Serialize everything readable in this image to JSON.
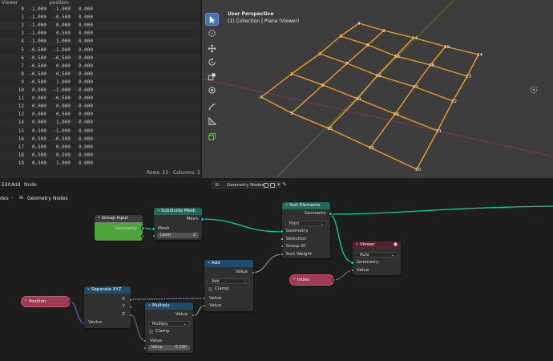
{
  "spreadsheet": {
    "header": {
      "viewer": "Viewer",
      "position": "position"
    },
    "rows": [
      {
        "i": "0",
        "x": "-1.000",
        "y": "-1.000",
        "z": "0.000"
      },
      {
        "i": "1",
        "x": "-1.000",
        "y": "-0.500",
        "z": "0.000"
      },
      {
        "i": "2",
        "x": "-1.000",
        "y": "0.000",
        "z": "0.000"
      },
      {
        "i": "3",
        "x": "-1.000",
        "y": "0.500",
        "z": "0.000"
      },
      {
        "i": "4",
        "x": "-1.000",
        "y": "1.000",
        "z": "0.000"
      },
      {
        "i": "5",
        "x": "-0.500",
        "y": "-1.000",
        "z": "0.000"
      },
      {
        "i": "6",
        "x": "-0.500",
        "y": "-0.500",
        "z": "0.000"
      },
      {
        "i": "7",
        "x": "-0.500",
        "y": "0.000",
        "z": "0.000"
      },
      {
        "i": "8",
        "x": "-0.500",
        "y": "0.500",
        "z": "0.000"
      },
      {
        "i": "9",
        "x": "-0.500",
        "y": "1.000",
        "z": "0.000"
      },
      {
        "i": "10",
        "x": "0.000",
        "y": "-1.000",
        "z": "0.000"
      },
      {
        "i": "11",
        "x": "0.000",
        "y": "-0.500",
        "z": "0.000"
      },
      {
        "i": "12",
        "x": "0.000",
        "y": "0.000",
        "z": "0.000"
      },
      {
        "i": "13",
        "x": "0.000",
        "y": "0.500",
        "z": "0.000"
      },
      {
        "i": "14",
        "x": "0.000",
        "y": "1.000",
        "z": "0.000"
      },
      {
        "i": "15",
        "x": "0.500",
        "y": "-1.000",
        "z": "0.000"
      },
      {
        "i": "16",
        "x": "0.500",
        "y": "-0.500",
        "z": "0.000"
      },
      {
        "i": "17",
        "x": "0.500",
        "y": "0.000",
        "z": "0.000"
      },
      {
        "i": "18",
        "x": "0.500",
        "y": "0.500",
        "z": "0.000"
      },
      {
        "i": "19",
        "x": "0.500",
        "y": "1.000",
        "z": "0.000"
      }
    ],
    "rows_label": "Rows: 25",
    "columns_label": "Columns: 2"
  },
  "viewport": {
    "view_name": "User Perspective",
    "collection_info": "(1) Collection | Plane (Viewer)",
    "vertex_labels": [
      "0",
      "1",
      "2",
      "3",
      "4",
      "5",
      "6",
      "7",
      "8",
      "9",
      "10",
      "11",
      "12",
      "13",
      "14",
      "15",
      "16",
      "17",
      "18",
      "19",
      "20",
      "21",
      "22",
      "23",
      "24"
    ],
    "colors": {
      "edge": "#f39c2a",
      "x_axis": "#a3475b",
      "y_axis": "#6b8e23"
    }
  },
  "node_editor": {
    "menu": {
      "edit": "Edit",
      "add": "Add",
      "node": "Node"
    },
    "breadcrumb_left": "des",
    "breadcrumb": "Geometry Nodes",
    "tree_name": "Geometry Nodes",
    "nodes": {
      "group_input": {
        "title": "Group Input",
        "geometry": "Geometry"
      },
      "subdivide": {
        "title": "Subdivide Mesh",
        "out_mesh": "Mesh",
        "in_mesh": "Mesh",
        "level_label": "Level",
        "level_value": "2"
      },
      "sort": {
        "title": "Sort Elements",
        "out_geometry": "Geometry",
        "domain": "Point",
        "geometry": "Geometry",
        "selection": "Selection",
        "group_id": "Group ID",
        "sort_weight": "Sort Weight"
      },
      "add": {
        "title": "Add",
        "out_value": "Value",
        "operation": "Add",
        "clamp": "Clamp",
        "value1": "Value",
        "value2": "Value"
      },
      "viewer": {
        "title": "Viewer",
        "domain": "Auto",
        "geometry": "Geometry",
        "value": "Value"
      },
      "index": {
        "title": "Index"
      },
      "position": {
        "title": "Position"
      },
      "separate": {
        "title": "Separate XYZ",
        "x": "X",
        "y": "Y",
        "z": "Z",
        "vector": "Vector"
      },
      "multiply": {
        "title": "Multiply",
        "out_value": "Value",
        "operation": "Multiply",
        "clamp": "Clamp",
        "value": "Value",
        "value2_label": "Value",
        "value2": "0.100"
      }
    },
    "colors": {
      "geometry_link": "#00d6a3",
      "float_link": "#a1a1a1",
      "vector_link": "#6363c7"
    }
  }
}
